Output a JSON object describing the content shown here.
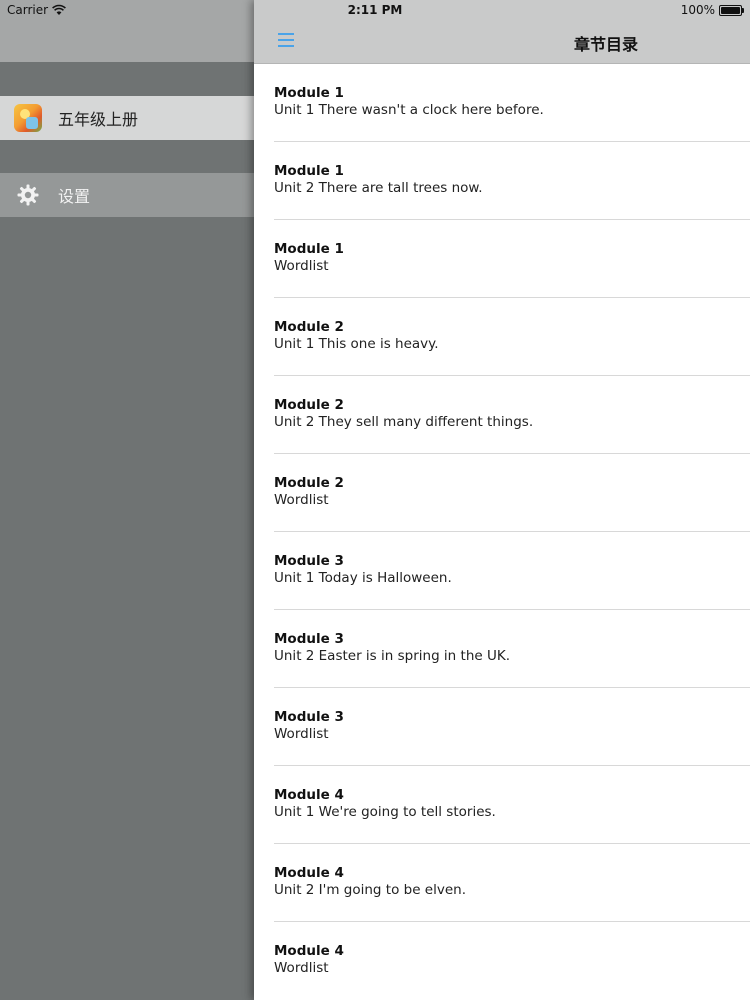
{
  "status_bar": {
    "carrier": "Carrier",
    "time": "2:11 PM",
    "battery": "100%"
  },
  "sidebar": {
    "items": [
      {
        "label": "五年级上册",
        "icon": "book-cover-icon"
      },
      {
        "label": "设置",
        "icon": "gear-icon"
      }
    ]
  },
  "nav": {
    "title": "章节目录",
    "menu_icon": "hamburger-menu-icon"
  },
  "colors": {
    "accent": "#4aa3e8",
    "nav_bg": "#c9caca",
    "sidebar_bg": "#6f7373"
  },
  "chapters": [
    {
      "module": "Module 1",
      "unit": "Unit 1 There wasn't a clock here before."
    },
    {
      "module": "Module 1",
      "unit": "Unit 2 There are tall trees now."
    },
    {
      "module": "Module 1",
      "unit": "Wordlist"
    },
    {
      "module": "Module 2",
      "unit": "Unit 1 This one is heavy."
    },
    {
      "module": "Module 2",
      "unit": "Unit 2 They sell many different things."
    },
    {
      "module": "Module 2",
      "unit": "Wordlist"
    },
    {
      "module": "Module 3",
      "unit": "Unit 1 Today is Halloween."
    },
    {
      "module": "Module 3",
      "unit": "Unit 2 Easter is in spring in the UK."
    },
    {
      "module": "Module 3",
      "unit": "Wordlist"
    },
    {
      "module": "Module 4",
      "unit": "Unit 1 We're going to tell stories."
    },
    {
      "module": "Module 4",
      "unit": "Unit 2 I'm going to be elven."
    },
    {
      "module": "Module 4",
      "unit": "Wordlist"
    }
  ]
}
